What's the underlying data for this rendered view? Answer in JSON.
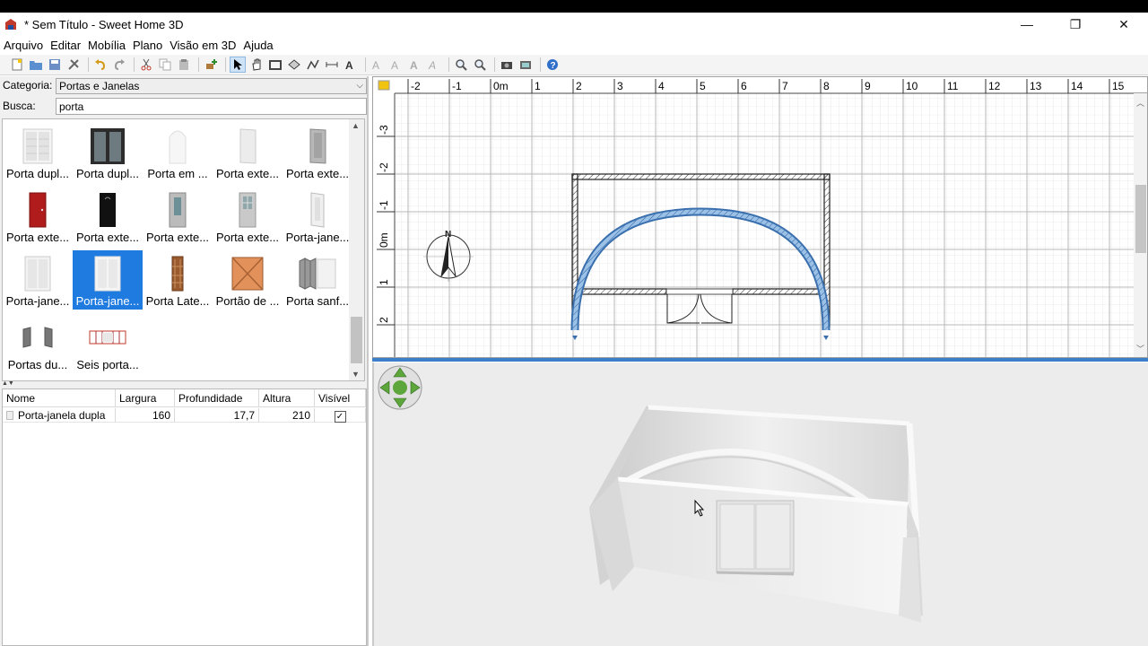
{
  "window": {
    "title": "* Sem Título - Sweet Home 3D",
    "minimize": "—",
    "restore": "❐",
    "close": "✕"
  },
  "menu": [
    "Arquivo",
    "Editar",
    "Mobília",
    "Plano",
    "Visão em 3D",
    "Ajuda"
  ],
  "catalog": {
    "category_label": "Categoria:",
    "category_value": "Portas e Janelas",
    "search_label": "Busca:",
    "search_value": "porta",
    "items": [
      {
        "label": "Porta dupl...",
        "selected": false
      },
      {
        "label": "Porta dupl...",
        "selected": false
      },
      {
        "label": "Porta em ...",
        "selected": false
      },
      {
        "label": "Porta exte...",
        "selected": false
      },
      {
        "label": "Porta exte...",
        "selected": false
      },
      {
        "label": "Porta exte...",
        "selected": false
      },
      {
        "label": "Porta exte...",
        "selected": false
      },
      {
        "label": "Porta exte...",
        "selected": false
      },
      {
        "label": "Porta exte...",
        "selected": false
      },
      {
        "label": "Porta-jane...",
        "selected": false
      },
      {
        "label": "Porta-jane...",
        "selected": false
      },
      {
        "label": "Porta-jane...",
        "selected": true
      },
      {
        "label": "Porta Late...",
        "selected": false
      },
      {
        "label": "Portão de ...",
        "selected": false
      },
      {
        "label": "Porta sanf...",
        "selected": false
      },
      {
        "label": "Portas du...",
        "selected": false
      },
      {
        "label": "Seis porta...",
        "selected": false
      }
    ]
  },
  "furniture_table": {
    "columns": [
      "Nome",
      "Largura",
      "Profundidade",
      "Altura",
      "Visível"
    ],
    "rows": [
      {
        "name": "Porta-janela dupla",
        "width": "160",
        "depth": "17,7",
        "height": "210",
        "visible": "✓"
      }
    ]
  },
  "plan": {
    "ruler_x": [
      "-2",
      "-1",
      "0m",
      "1",
      "2",
      "3",
      "4",
      "5",
      "6",
      "7",
      "8",
      "9",
      "10",
      "11",
      "12",
      "13",
      "14",
      "15"
    ],
    "ruler_y": [
      "-3",
      "-2",
      "-1",
      "0m",
      "1",
      "2"
    ],
    "compass_label": "N"
  },
  "colors": {
    "selection": "#1f7be0",
    "wall_selected": "#6aa0d8",
    "grid": "#d8d8d8",
    "view3d_bg": "#ececec"
  }
}
